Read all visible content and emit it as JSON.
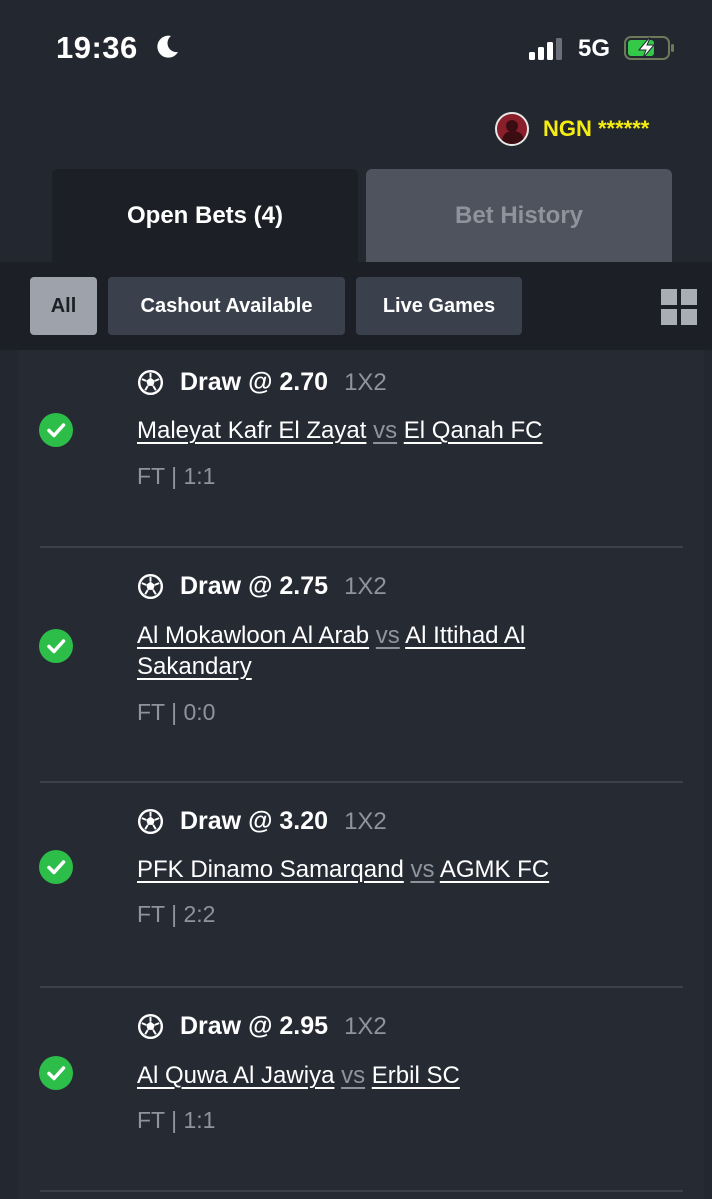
{
  "status_bar": {
    "time": "19:36",
    "network": "5G"
  },
  "account": {
    "balance_label": "NGN ******"
  },
  "tabs": [
    {
      "label": "Open Bets (4)",
      "active": true
    },
    {
      "label": "Bet History",
      "active": false
    }
  ],
  "filters": [
    {
      "label": "All",
      "active": true
    },
    {
      "label": "Cashout Available",
      "active": false
    },
    {
      "label": "Live Games",
      "active": false
    }
  ],
  "bets": [
    {
      "pick": "Draw @ 2.70",
      "market": "1X2",
      "home": "Maleyat Kafr El Zayat",
      "vs": "vs",
      "away": "El Qanah FC",
      "result": "FT | 1:1",
      "status": "won"
    },
    {
      "pick": "Draw @ 2.75",
      "market": "1X2",
      "home": "Al Mokawloon Al Arab",
      "vs": "vs",
      "away": "Al Ittihad Al Sakandary",
      "result": "FT | 0:0",
      "status": "won"
    },
    {
      "pick": "Draw @ 3.20",
      "market": "1X2",
      "home": "PFK Dinamo Samarqand",
      "vs": "vs",
      "away": "AGMK FC",
      "result": "FT | 2:2",
      "status": "won"
    },
    {
      "pick": "Draw @ 2.95",
      "market": "1X2",
      "home": "Al Quwa Al Jawiya",
      "vs": "vs",
      "away": "Erbil SC",
      "result": "FT | 1:1",
      "status": "won"
    }
  ],
  "colors": {
    "accent_yellow": "#f5ec12",
    "success_green": "#2dbe4a",
    "background": "#23272f"
  }
}
